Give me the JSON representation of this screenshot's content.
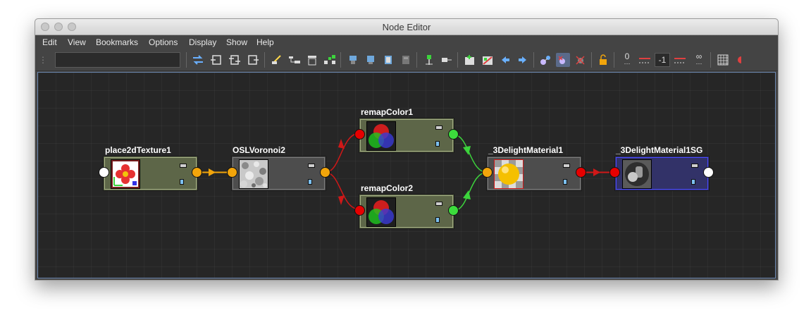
{
  "window": {
    "title": "Node Editor"
  },
  "menu": [
    "Edit",
    "View",
    "Bookmarks",
    "Options",
    "Display",
    "Show",
    "Help"
  ],
  "toolbar": {
    "search_value": "",
    "counters": [
      "0",
      "-1",
      "∞"
    ]
  },
  "nodes": {
    "place2d": {
      "label": "place2dTexture1"
    },
    "voronoi": {
      "label": "OSLVoronoi2"
    },
    "remap1": {
      "label": "remapColor1"
    },
    "remap2": {
      "label": "remapColor2"
    },
    "material": {
      "label": "_3DelightMaterial1"
    },
    "sg": {
      "label": "_3DelightMaterial1SG"
    }
  },
  "colors": {
    "node_green": "#5d6648",
    "node_gray": "#4d4d4d",
    "node_sg": "#323268",
    "port_orange": "#f2a50b",
    "port_red": "#e60000",
    "port_green": "#3cdc3c",
    "port_white": "#ffffff",
    "wire_orange": "#f2a50b",
    "wire_red": "#d01818",
    "wire_green": "#3cd43c"
  }
}
